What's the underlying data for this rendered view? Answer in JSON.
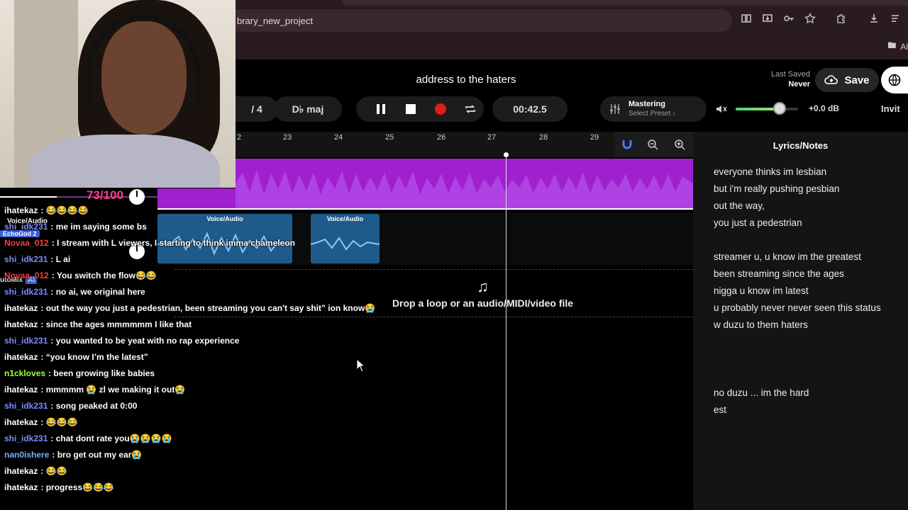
{
  "browser": {
    "url_text": "brary_new_project",
    "bookmarks_label": "Al"
  },
  "header": {
    "project_title": "address to the haters",
    "last_saved_label": "Last Saved",
    "last_saved_value": "Never",
    "save_label": "Save"
  },
  "transport": {
    "bar_position": "/ 4",
    "key": "D♭ maj",
    "time": "00:42.5",
    "mastering_label": "Mastering",
    "mastering_preset": "Select Preset",
    "volume_db": "+0.0 dB",
    "volume_level": 0.7,
    "invite_label": "Invit"
  },
  "ruler": {
    "marks": [
      "2",
      "23",
      "24",
      "25",
      "26",
      "27",
      "28",
      "29"
    ]
  },
  "tracks": {
    "clip1_title": "Voice/Audio",
    "clip2_title": "Voice/Audio",
    "drop_text": "Drop a loop or an audio/MIDI/video file"
  },
  "lyrics": {
    "title": "Lyrics/Notes",
    "lines": [
      "everyone thinks im lesbian",
      "but i'm really pushing pesbian",
      "out the way,",
      "you just a pedestrian",
      "",
      "streamer u, u know im the greatest",
      "been streaming since the ages",
      "nigga u know im latest",
      "u probably never never seen this status",
      "w duzu to them haters",
      "",
      "",
      "",
      "no duzu ... im the hard",
      "est"
    ]
  },
  "overlay": {
    "score": "73/100",
    "echo_badge": "EchoGod 2",
    "voice_audio": "Voice/Audio",
    "automix": "utoMix",
    "ai_badge": "AI",
    "progress": 0.36
  },
  "chat": [
    {
      "user": "ihatekaz",
      "color": "#ffffff",
      "msg": ": 😂😂😂😂"
    },
    {
      "user": "shi_idk231",
      "color": "#7b8cff",
      "msg": ": me im saying some bs"
    },
    {
      "user": "Novaa_012",
      "color": "#ff3b3b",
      "msg": ": I stream with L viewers, I starting to think imma chameleon"
    },
    {
      "user": "shi_idk231",
      "color": "#7b8cff",
      "msg": ": L ai"
    },
    {
      "user": "Novaa_012",
      "color": "#ff3b3b",
      "msg": ": You switch the flow😂😂"
    },
    {
      "user": "shi_idk231",
      "color": "#7b8cff",
      "msg": ": no ai, we original here"
    },
    {
      "user": "ihatekaz",
      "color": "#ffffff",
      "msg": ": out the way you just a pedestrian, been streaming you can't say shit” ion know😭"
    },
    {
      "user": "ihatekaz",
      "color": "#ffffff",
      "msg": ": since the ages mmmmmm I like that"
    },
    {
      "user": "shi_idk231",
      "color": "#7b8cff",
      "msg": ": you wanted to be yeat with no rap experience"
    },
    {
      "user": "ihatekaz",
      "color": "#ffffff",
      "msg": ": “you know I’m the latest”"
    },
    {
      "user": "n1ckloves",
      "color": "#9dff3b",
      "msg": ": been growing like babies"
    },
    {
      "user": "ihatekaz",
      "color": "#ffffff",
      "msg": ": mmmmm 😭 zl we making it out😭"
    },
    {
      "user": "shi_idk231",
      "color": "#7b8cff",
      "msg": ": song peaked at 0:00"
    },
    {
      "user": "ihatekaz",
      "color": "#ffffff",
      "msg": ": 😂😂😂"
    },
    {
      "user": "shi_idk231",
      "color": "#7b8cff",
      "msg": ": chat dont rate you😭😭😭😭"
    },
    {
      "user": "nan0ishere",
      "color": "#6fb3ff",
      "msg": ": bro get out my ear😭"
    },
    {
      "user": "ihatekaz",
      "color": "#ffffff",
      "msg": ": 😂😂"
    },
    {
      "user": "ihatekaz",
      "color": "#ffffff",
      "msg": ": progress😂😂😂"
    }
  ],
  "colors": {
    "accent_purple": "#a020d0",
    "clip_blue": "#1f5b8a",
    "record_red": "#e21b1b",
    "score_pink": "#ff3c8c"
  },
  "icons": [
    "pause-icon",
    "stop-icon",
    "record-icon",
    "loop-icon",
    "volume-icon",
    "magnet-icon",
    "zoom-out-icon",
    "zoom-in-icon",
    "cloud-upload-icon",
    "globe-icon",
    "music-note-icon",
    "mixer-sliders-icon"
  ]
}
